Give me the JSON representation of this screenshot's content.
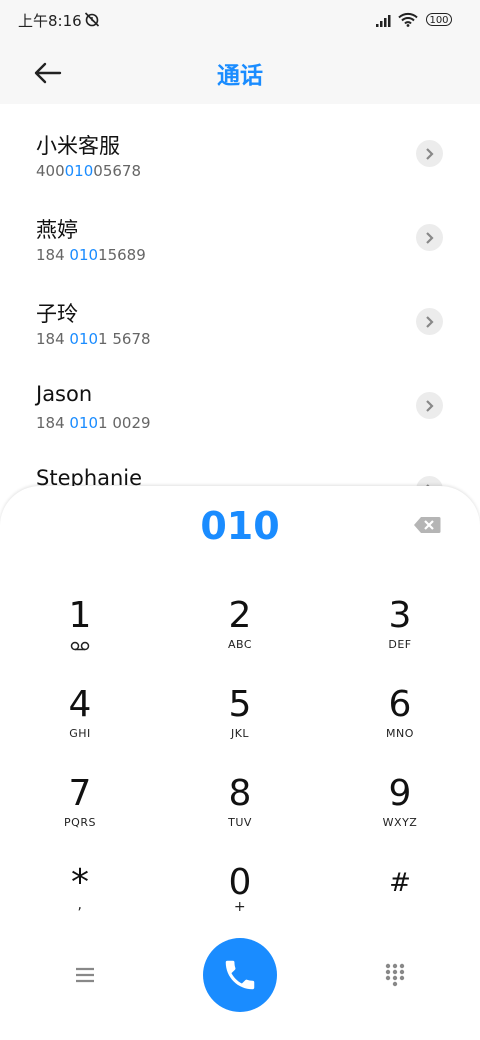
{
  "status": {
    "time": "上午8:16",
    "battery": "100"
  },
  "header": {
    "title": "通话"
  },
  "contacts": [
    {
      "name": "小米客服",
      "num_pre": "400",
      "num_hl": "010",
      "num_post": "05678"
    },
    {
      "name": "燕婷",
      "num_pre": "184 ",
      "num_hl": "010",
      "num_post": "15689"
    },
    {
      "name": "子玲",
      "num_pre": "184 ",
      "num_hl": "010",
      "num_post": "1 5678"
    },
    {
      "name": "Jason",
      "num_pre": "184 ",
      "num_hl": "010",
      "num_post": "1 0029"
    },
    {
      "name": "Stephanie",
      "num_pre": "",
      "num_hl": "",
      "num_post": ""
    }
  ],
  "dialer": {
    "number": "010",
    "keys": [
      {
        "digit": "1",
        "letters": ""
      },
      {
        "digit": "2",
        "letters": "ABC"
      },
      {
        "digit": "3",
        "letters": "DEF"
      },
      {
        "digit": "4",
        "letters": "GHI"
      },
      {
        "digit": "5",
        "letters": "JKL"
      },
      {
        "digit": "6",
        "letters": "MNO"
      },
      {
        "digit": "7",
        "letters": "PQRS"
      },
      {
        "digit": "8",
        "letters": "TUV"
      },
      {
        "digit": "9",
        "letters": "WXYZ"
      },
      {
        "digit": "*",
        "letters": ","
      },
      {
        "digit": "0",
        "letters": "+"
      },
      {
        "digit": "#",
        "letters": ""
      }
    ]
  },
  "colors": {
    "accent": "#1a8cff"
  }
}
